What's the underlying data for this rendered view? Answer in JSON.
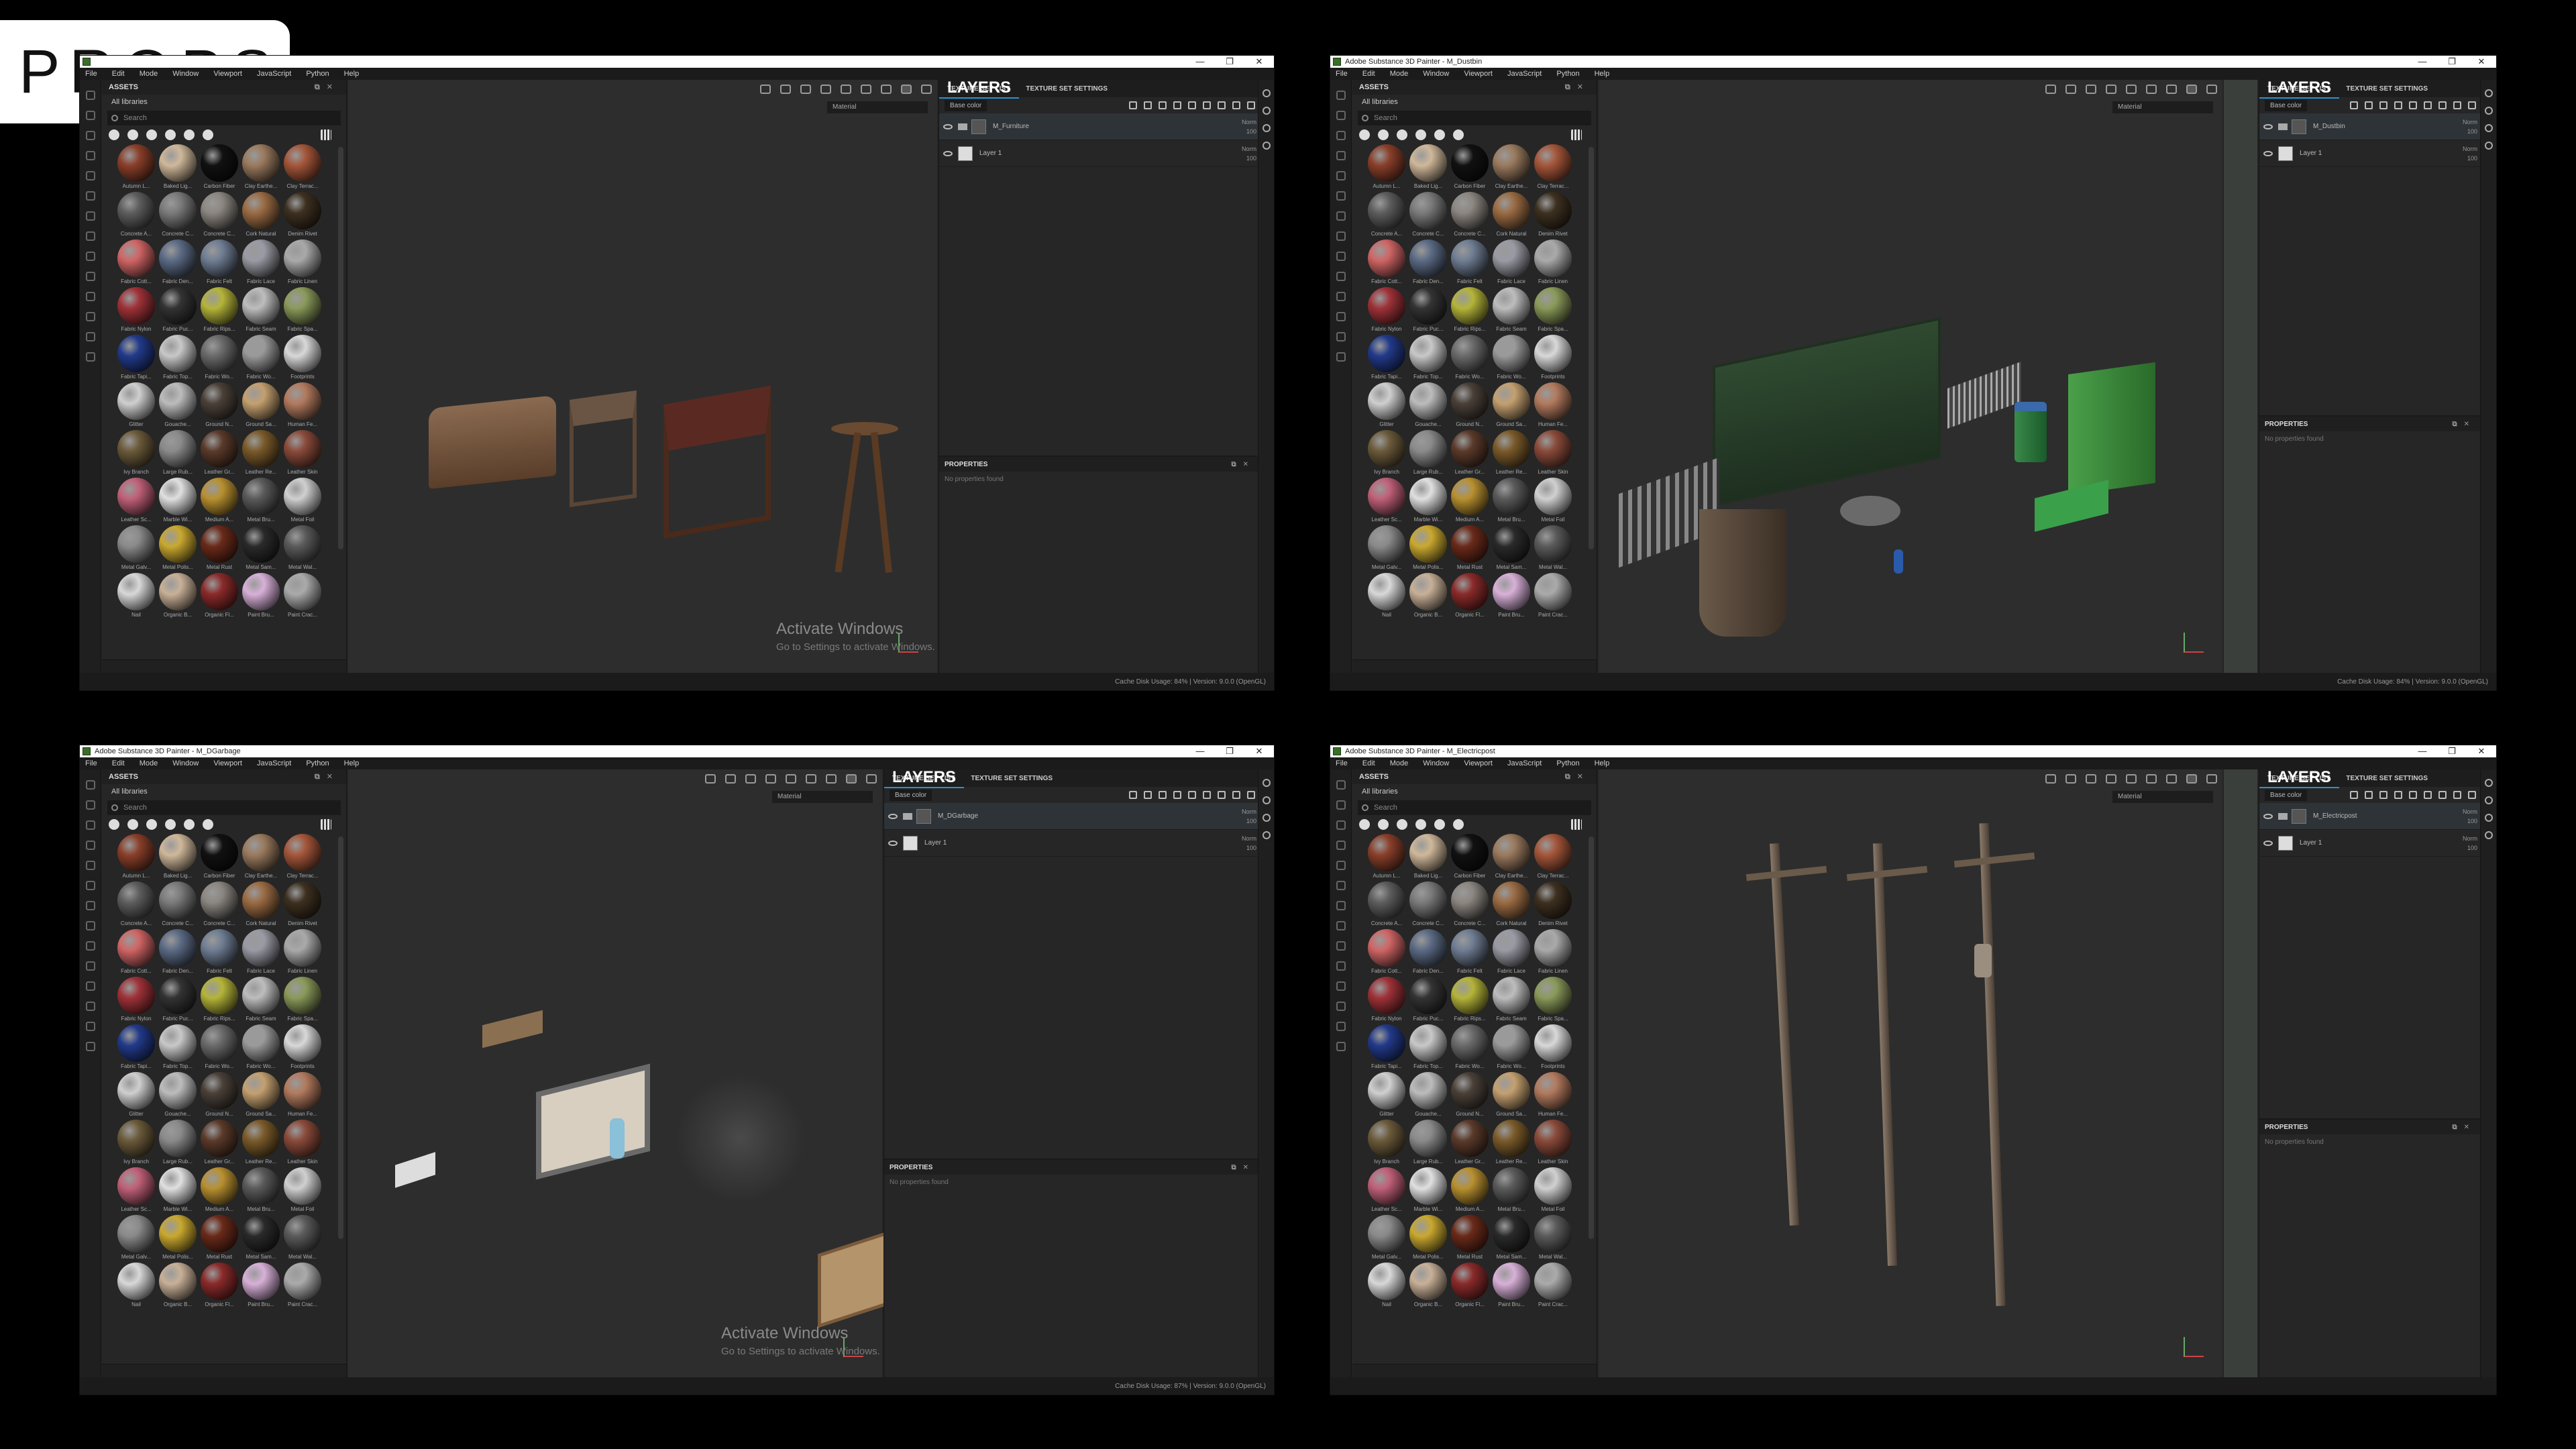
{
  "banner": {
    "label": "PROPS"
  },
  "app": {
    "menu": [
      "File",
      "Edit",
      "Mode",
      "Window",
      "Viewport",
      "JavaScript",
      "Python",
      "Help"
    ],
    "window_controls": [
      "—",
      "❐",
      "✕"
    ],
    "assets": {
      "title": "ASSETS",
      "library": "All libraries",
      "search_placeholder": "Search",
      "materials": [
        {
          "label": "Autumn L...",
          "color": "#8a3f2a"
        },
        {
          "label": "Baked Lig...",
          "color": "#cfb89a"
        },
        {
          "label": "Carbon Fiber",
          "color": "#111111"
        },
        {
          "label": "Clay Earthe...",
          "color": "#9a7a5e"
        },
        {
          "label": "Clay Terrac...",
          "color": "#a5563a"
        },
        {
          "label": "Concrete A...",
          "color": "#5d5d5d"
        },
        {
          "label": "Concrete C...",
          "color": "#7a7a7a"
        },
        {
          "label": "Concrete C...",
          "color": "#8b8680"
        },
        {
          "label": "Cork Natural",
          "color": "#9a6b43"
        },
        {
          "label": "Denim Rivet",
          "color": "#3d3020"
        },
        {
          "label": "Fabric Cott...",
          "color": "#d06565"
        },
        {
          "label": "Fabric Den...",
          "color": "#5b6a84"
        },
        {
          "label": "Fabric Felt",
          "color": "#6f7d93"
        },
        {
          "label": "Fabric Lace",
          "color": "#9a9aa4"
        },
        {
          "label": "Fabric Linen",
          "color": "#a9a9a9"
        },
        {
          "label": "Fabric Nylon",
          "color": "#9e3238"
        },
        {
          "label": "Fabric Puc...",
          "color": "#333333"
        },
        {
          "label": "Fabric Rips...",
          "color": "#b4b43a"
        },
        {
          "label": "Fabric Seam",
          "color": "#bdbdbd"
        },
        {
          "label": "Fabric Spa...",
          "color": "#8a9a5a"
        },
        {
          "label": "Fabric Tapi...",
          "color": "#223a8a"
        },
        {
          "label": "Fabric Top...",
          "color": "#c8c8c8"
        },
        {
          "label": "Fabric Wo...",
          "color": "#6a6a6a"
        },
        {
          "label": "Fabric Wo...",
          "color": "#9a9a9a"
        },
        {
          "label": "Footprints",
          "color": "#d8d8d8"
        },
        {
          "label": "Glitter",
          "color": "#cfcfcf"
        },
        {
          "label": "Gouache...",
          "color": "#bcbcbc"
        },
        {
          "label": "Ground N...",
          "color": "#4a4038"
        },
        {
          "label": "Ground Sa...",
          "color": "#c4a070"
        },
        {
          "label": "Human Fe...",
          "color": "#b27a5e"
        },
        {
          "label": "Ivy Branch",
          "color": "#6b5a3a"
        },
        {
          "label": "Large Rub...",
          "color": "#8a8a8a"
        },
        {
          "label": "Leather Gr...",
          "color": "#5a3a2a"
        },
        {
          "label": "Leather Re...",
          "color": "#7a5a2a"
        },
        {
          "label": "Leather Skin",
          "color": "#8a4a3a"
        },
        {
          "label": "Leather Sc...",
          "color": "#c06078"
        },
        {
          "label": "Marble Wi...",
          "color": "#e0e0e0"
        },
        {
          "label": "Medium A...",
          "color": "#b89030"
        },
        {
          "label": "Metal Bru...",
          "color": "#5a5a5a"
        },
        {
          "label": "Metal Foil",
          "color": "#d0d0d0"
        },
        {
          "label": "Metal Galv...",
          "color": "#8a8a8a"
        },
        {
          "label": "Metal Polis...",
          "color": "#c9a830"
        },
        {
          "label": "Metal Rust",
          "color": "#6a2a1a"
        },
        {
          "label": "Metal Sam...",
          "color": "#2a2a2a"
        },
        {
          "label": "Metal Wal...",
          "color": "#5a5a5a"
        },
        {
          "label": "Nail",
          "color": "#d8d8d8"
        },
        {
          "label": "Organic B...",
          "color": "#c8b098"
        },
        {
          "label": "Organic Fl...",
          "color": "#8a2a2a"
        },
        {
          "label": "Paint Bru...",
          "color": "#d8b0d8"
        },
        {
          "label": "Paint Crac...",
          "color": "#aaaaaa"
        }
      ]
    },
    "viewport": {
      "material_mode": "Material"
    },
    "layers": {
      "tabs": [
        "LAYERS",
        "TEXTURE SET LIST",
        "TEXTURE SET SETTINGS"
      ],
      "channel": "Base color",
      "layer_name": "Layer 1",
      "blend_mode": "Norm",
      "opacity": "100"
    },
    "properties": {
      "title": "PROPERTIES",
      "message": "No properties found"
    },
    "activation": {
      "title": "Activate Windows",
      "subtitle": "Go to Settings to activate Windows."
    }
  },
  "windows": [
    {
      "title": "",
      "group_name": "M_Furniture",
      "status": "Cache Disk Usage:   84% | Version: 9.0.0 (OpenGL)"
    },
    {
      "title": "Adobe Substance 3D Painter - M_Dustbin",
      "group_name": "M_Dustbin",
      "status": "Cache Disk Usage:   84% | Version: 9.0.0 (OpenGL)"
    },
    {
      "title": "Adobe Substance 3D Painter - M_DGarbage",
      "group_name": "M_DGarbage",
      "status": "Cache Disk Usage:   87% | Version: 9.0.0 (OpenGL)"
    },
    {
      "title": "Adobe Substance 3D Painter - M_Electricpost",
      "group_name": "M_Electricpost",
      "status": ""
    }
  ]
}
